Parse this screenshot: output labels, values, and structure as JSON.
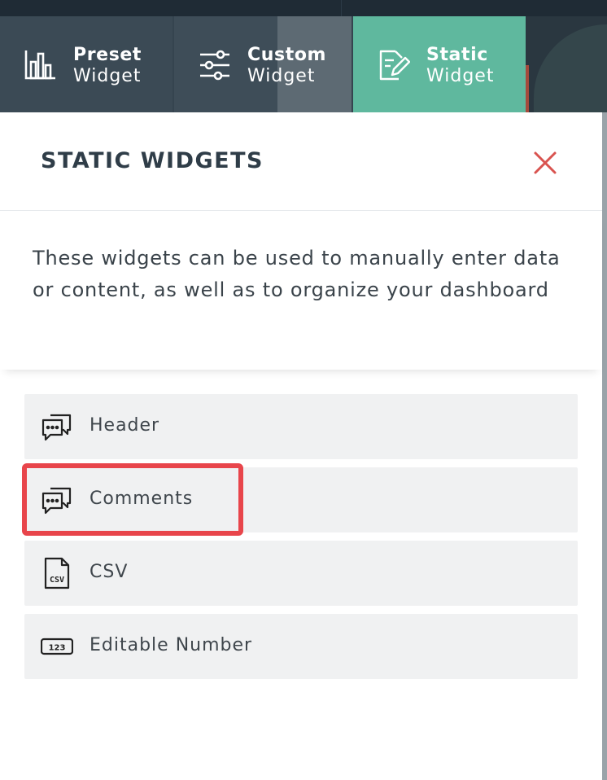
{
  "tabs": [
    {
      "line1": "Preset",
      "line2": "Widget",
      "icon": "bar-chart-icon",
      "active": false
    },
    {
      "line1": "Custom",
      "line2": "Widget",
      "icon": "sliders-icon",
      "active": false
    },
    {
      "line1": "Static",
      "line2": "Widget",
      "icon": "edit-document-icon",
      "active": true
    }
  ],
  "panel": {
    "title": "STATIC WIDGETS",
    "close_icon": "close-icon",
    "description": "These widgets can be used to manually enter data or content, as well as to organize your dashboard"
  },
  "items": [
    {
      "label": "Header",
      "icon": "chat-bubbles-icon"
    },
    {
      "label": "Comments",
      "icon": "chat-bubbles-icon"
    },
    {
      "label": "CSV",
      "icon": "csv-file-icon"
    },
    {
      "label": "Editable Number",
      "icon": "number-badge-icon"
    }
  ],
  "icon_texts": {
    "csv": "CSV",
    "number": "123"
  },
  "colors": {
    "tab_bg": "#3b4a55",
    "tab_active": "#5fb89e",
    "close_red": "#d9534f",
    "highlight_red": "#e8454b",
    "item_bg": "#f0f1f2"
  }
}
